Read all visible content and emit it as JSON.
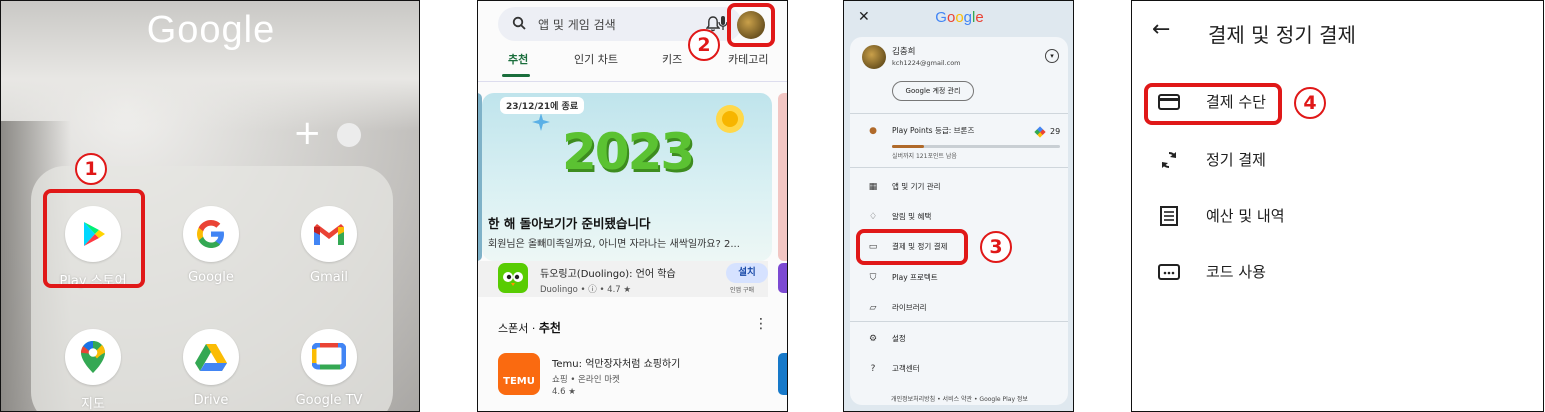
{
  "panel1": {
    "folder_title": "Google",
    "add_symbol": "+",
    "apps": [
      {
        "label": "Play 스토어",
        "icon": "play-store-icon"
      },
      {
        "label": "Google",
        "icon": "google-icon"
      },
      {
        "label": "Gmail",
        "icon": "gmail-icon"
      },
      {
        "label": "지도",
        "icon": "maps-icon"
      },
      {
        "label": "Drive",
        "icon": "drive-icon"
      },
      {
        "label": "Google TV",
        "icon": "google-tv-icon"
      }
    ],
    "callout": "1"
  },
  "panel2": {
    "search_placeholder": "앱 및 게임 검색",
    "tabs": [
      "추천",
      "인기 차트",
      "키즈",
      "카테고리"
    ],
    "banner_chip": "23/12/21에 종료",
    "banner_art": "2023",
    "banner_title": "한 해 돌아보기가 준비됐습니다",
    "banner_subtitle": "회원님은 올빼미족일까요, 아니면 자라나는 새싹일까요? 2...",
    "duo_name": "듀오링고(Duolingo): 언어 학습",
    "duo_meta": "Duolingo • ⓘ • 4.7 ★",
    "install_label": "설치",
    "install_sub": "인앱 구매",
    "section_sponsor": "스폰서 · ",
    "section_title": "추천",
    "temu_logo": "TEMU",
    "temu_name": "Temu: 억만장자처럼 쇼핑하기",
    "temu_category": "쇼핑 • 온라인 마켓",
    "temu_rating": "4.6 ★",
    "callout": "2"
  },
  "panel3": {
    "close": "✕",
    "logo": "Google",
    "user_name": "김충희",
    "user_email": "kch1224@gmail.com",
    "manage_account": "Google 계정 관리",
    "play_points": "Play Points 등급: 브론즈",
    "play_points_count": "29",
    "play_points_sub": "실버까지 121포인트 남음",
    "play_points_progress": 0.19,
    "menu": [
      {
        "label": "앱 및 기기 관리",
        "icon": "apps-manage-icon"
      },
      {
        "label": "알림 및 혜택",
        "icon": "bell-icon"
      },
      {
        "label": "결제 및 정기 결제",
        "icon": "card-icon"
      },
      {
        "label": "Play 프로텍트",
        "icon": "shield-icon"
      },
      {
        "label": "라이브러리",
        "icon": "folder-icon"
      },
      {
        "label": "설정",
        "icon": "gear-icon"
      },
      {
        "label": "고객센터",
        "icon": "help-icon"
      }
    ],
    "footer": "개인정보처리방침  •  서비스 약관  •  Google Play 정보",
    "callout": "3"
  },
  "panel4": {
    "title": "결제 및 정기 결제",
    "rows": [
      {
        "label": "결제 수단",
        "icon": "card-icon"
      },
      {
        "label": "정기 결제",
        "icon": "sync-icon"
      },
      {
        "label": "예산 및 내역",
        "icon": "receipt-icon"
      },
      {
        "label": "코드 사용",
        "icon": "code-redeem-icon"
      }
    ],
    "callout": "4"
  },
  "colors": {
    "highlight": "#e01818",
    "play_green": "#1a6e3c"
  }
}
